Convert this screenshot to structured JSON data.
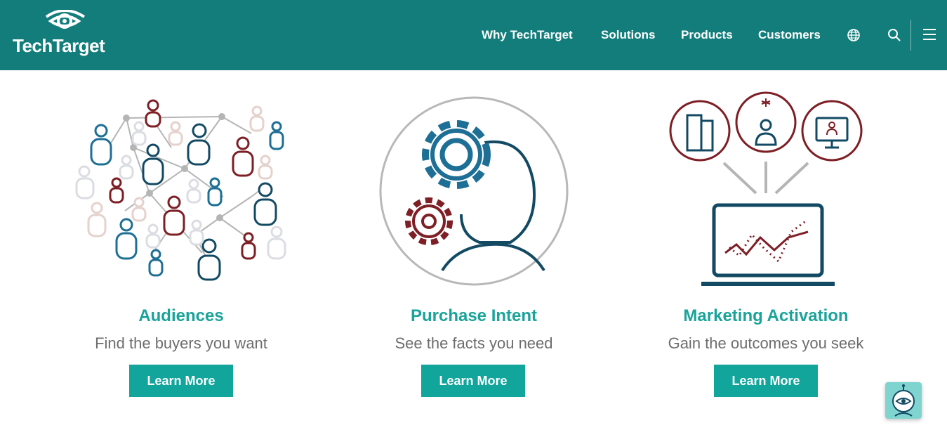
{
  "header": {
    "brand": "TechTarget",
    "nav": [
      "Why TechTarget",
      "Solutions",
      "Products",
      "Customers"
    ],
    "icons": [
      "globe-icon",
      "search-icon",
      "hamburger-menu-icon"
    ]
  },
  "cards": [
    {
      "title": "Audiences",
      "subtitle": "Find the buyers you want",
      "button": "Learn More"
    },
    {
      "title": "Purchase Intent",
      "subtitle": "See the facts you need",
      "button": "Learn More"
    },
    {
      "title": "Marketing Activation",
      "subtitle": "Gain the outcomes you seek",
      "button": "Learn More"
    }
  ],
  "colors": {
    "header_bg": "#127d7b",
    "accent": "#12a59c",
    "title": "#1aa39a",
    "dark_blue": "#134a63",
    "maroon": "#7d1f25",
    "mid_blue": "#1e6f95"
  },
  "chatbot": {
    "icon": "chatbot-icon"
  }
}
